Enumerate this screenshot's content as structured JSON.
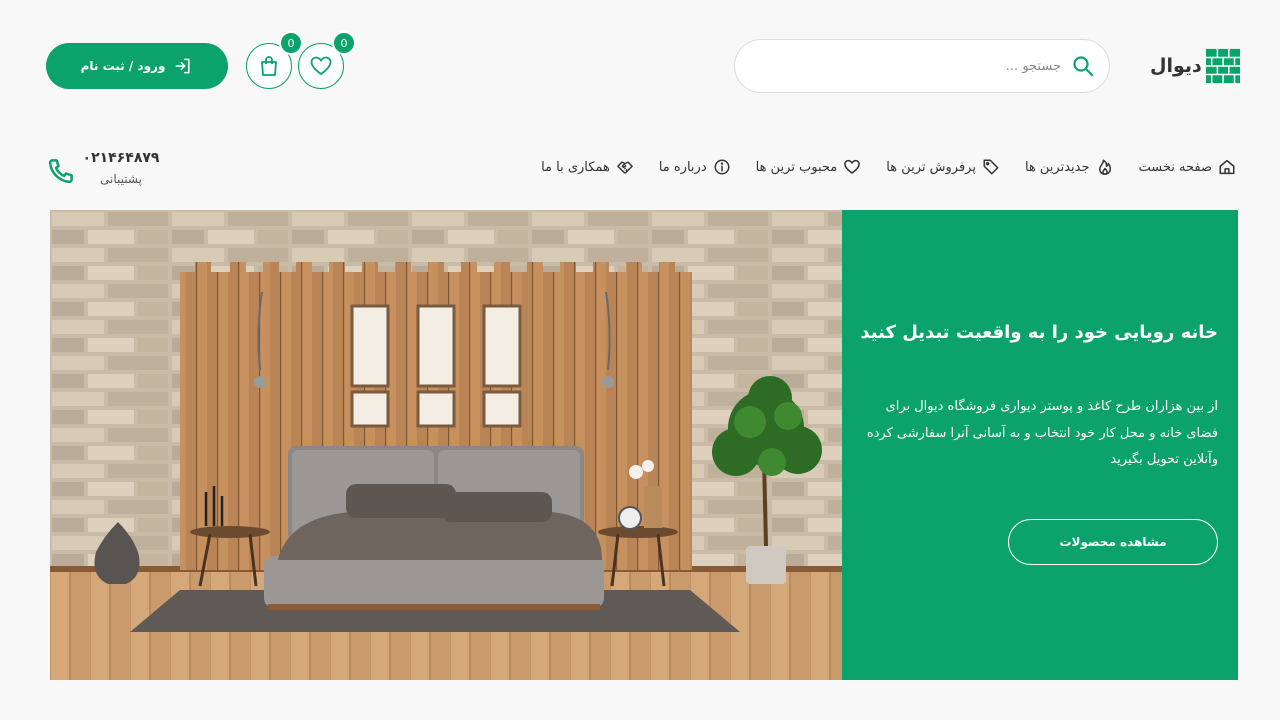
{
  "header": {
    "logo_text": "دیوال",
    "search_placeholder": "جستجو ...",
    "wishlist_count": "0",
    "cart_count": "0",
    "login_label": "ورود / ثبت نام"
  },
  "nav": {
    "items": [
      {
        "label": "صفحه نخست",
        "icon": "home-icon"
      },
      {
        "label": "جدیدترین ها",
        "icon": "fire-icon"
      },
      {
        "label": "پرفروش ترین ها",
        "icon": "tag-icon"
      },
      {
        "label": "محبوب ترین ها",
        "icon": "heart-icon"
      },
      {
        "label": "درباره ما",
        "icon": "info-icon"
      },
      {
        "label": "همکاری با ما",
        "icon": "handshake-icon"
      }
    ],
    "phone_number": "۰۲۱۴۶۴۸۷۹",
    "phone_label": "پشتیبانی"
  },
  "hero": {
    "title": "خانه رویایی خود را به واقعیت تبدیل کنید",
    "description": "از بین هزاران طرح کاغذ و پوستر دیواری فروشگاه دیوال برای فضای خانه و محل کار خود انتخاب و به آسانی آنرا سفارشی کرده وآنلاین تحویل بگیرید",
    "button_label": "مشاهده محصولات"
  },
  "colors": {
    "accent": "#0ba36b",
    "background": "#f8f8f8"
  }
}
